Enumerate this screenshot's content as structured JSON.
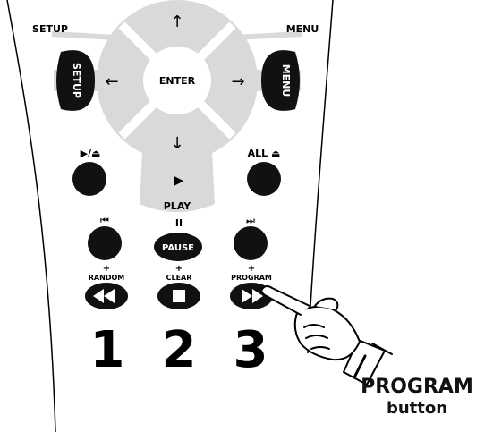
{
  "remote": {
    "setup_top_label": "SETUP",
    "menu_top_label": "MENU",
    "setup_button_label": "SETUP",
    "menu_button_label": "MENU",
    "enter_label": "ENTER",
    "arrow_up": "↑",
    "arrow_down": "↓",
    "arrow_left": "←",
    "arrow_right": "→",
    "play_symbol": "▶",
    "play_label": "PLAY",
    "play_eject_label": "▶/⏏",
    "all_eject_label": "ALL ⏏",
    "pause_symbol": "II",
    "pause_label": "PAUSE",
    "prev_label": "⏮",
    "next_label": "⏭",
    "plus": "+",
    "random_label": "RANDOM",
    "clear_label": "CLEAR",
    "program_label": "PROGRAM",
    "digit_1": "1",
    "digit_2": "2",
    "digit_3": "3"
  },
  "callout": {
    "line1": "PROGRAM",
    "line2": "button"
  },
  "colors": {
    "outline": "#000000",
    "dpad_gray": "#d9d9d9",
    "button_black": "#111111"
  }
}
